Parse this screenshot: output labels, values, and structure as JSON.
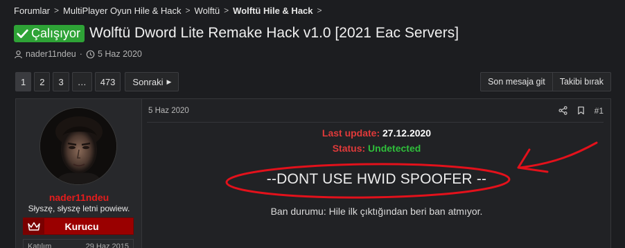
{
  "breadcrumb": {
    "items": [
      "Forumlar",
      "MultiPlayer Oyun Hile & Hack",
      "Wolftü",
      "Wolftü Hile & Hack"
    ],
    "separator": ">"
  },
  "thread": {
    "prefix_badge": "Çalışıyor",
    "title": "Wolftü Dword Lite Remake Hack v1.0 [2021 Eac Servers]",
    "author": "nader11ndeu",
    "date": "5 Haz 2020",
    "meta_sep": "·"
  },
  "pagination": {
    "pages": [
      "1",
      "2",
      "3",
      "…",
      "473"
    ],
    "active": "1",
    "next_label": "Sonraki"
  },
  "actions": {
    "last_message": "Son mesaja git",
    "follow": "Takibi bırak"
  },
  "post": {
    "date": "5 Haz 2020",
    "number": "#1",
    "user": {
      "name": "nader11ndeu",
      "title": "Słyszę, słyszę letni powiew.",
      "rank": "Kurucu",
      "join_label": "Katılım",
      "join_date": "29 Haz 2015"
    },
    "body": {
      "last_update_label": "Last update:",
      "last_update_value": "27.12.2020",
      "status_label": "Status:",
      "status_value": "Undetected",
      "warning": "--DONT USE HWID SPOOFER --",
      "ban_status": "Ban durumu: Hile ilk çıktığından beri ban atmıyor."
    }
  },
  "colors": {
    "badge_green": "#2ea336",
    "rank_red": "#9a0000",
    "username_red": "#e51c1c",
    "status_green": "#2fbf3b",
    "label_red": "#e03a3a",
    "annotation_red": "#e3111b"
  },
  "icons": [
    "check-icon",
    "user-icon",
    "clock-icon",
    "share-icon",
    "bookmark-icon",
    "crown-icon",
    "chevron-right-icon"
  ]
}
